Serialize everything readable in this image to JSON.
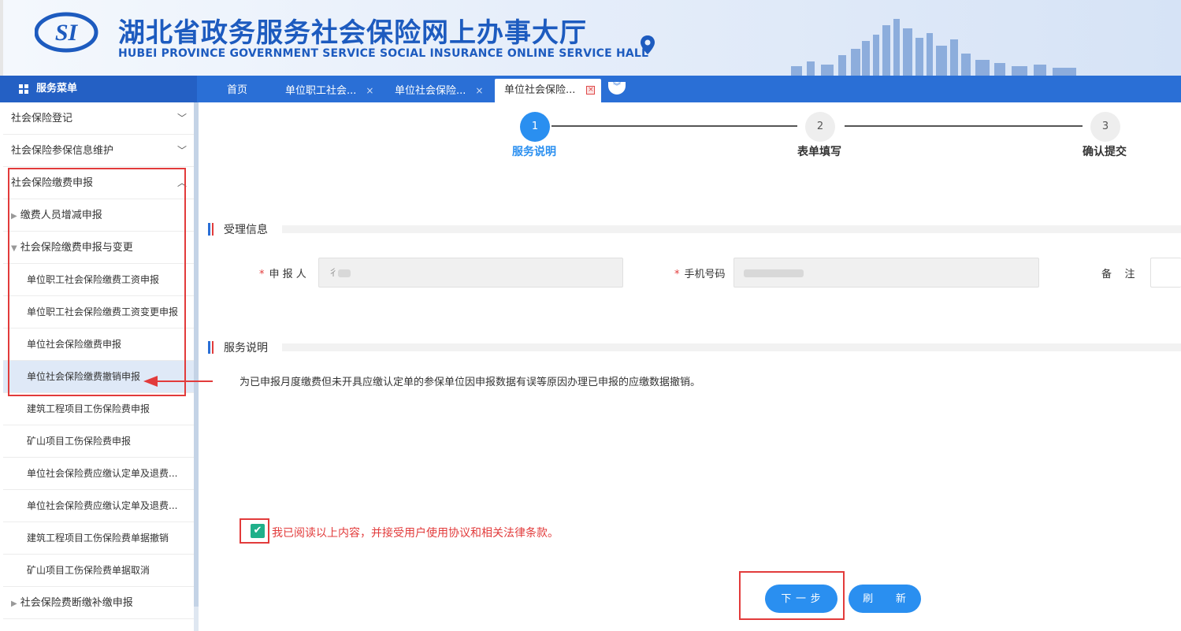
{
  "header": {
    "title": "湖北省政务服务社会保险网上办事大厅",
    "subtitle": "HUBEI PROVINCE GOVERNMENT SERVICE SOCIAL INSURANCE ONLINE SERVICE HALL",
    "logo_text": "SI"
  },
  "nav": {
    "menu_title": "服务菜单",
    "tabs": [
      {
        "label": "首页",
        "closable": false
      },
      {
        "label": "单位职工社会...",
        "closable": true
      },
      {
        "label": "单位社会保险...",
        "closable": true
      },
      {
        "label": "单位社会保险...",
        "closable": true,
        "active": true
      }
    ],
    "close_glyph": "×"
  },
  "sidebar": {
    "groups": [
      {
        "label": "社会保险登记",
        "icon": "chevron-down-icon",
        "chev": "﹀"
      },
      {
        "label": "社会保险参保信息维护",
        "icon": "chevron-down-icon",
        "chev": "﹀"
      },
      {
        "label": "社会保险缴费申报",
        "icon": "chevron-up-icon",
        "chev": "︿"
      }
    ],
    "subgroups": [
      {
        "label": "缴费人员增减申报",
        "tri": "▶"
      },
      {
        "label": "社会保险缴费申报与变更",
        "tri": "▼"
      }
    ],
    "leaves": [
      {
        "label": "单位职工社会保险缴费工资申报"
      },
      {
        "label": "单位职工社会保险缴费工资变更申报"
      },
      {
        "label": "单位社会保险缴费申报"
      },
      {
        "label": "单位社会保险缴费撤销申报",
        "selected": true
      },
      {
        "label": "建筑工程项目工伤保险费申报"
      },
      {
        "label": "矿山项目工伤保险费申报"
      },
      {
        "label": "单位社会保险费应缴认定单及退费..."
      },
      {
        "label": "单位社会保险费应缴认定单及退费..."
      },
      {
        "label": "建筑工程项目工伤保险费单据撤销"
      },
      {
        "label": "矿山项目工伤保险费单据取消"
      }
    ],
    "last_group": {
      "label": "社会保险费断缴补缴申报",
      "tri": "▶"
    }
  },
  "steps": [
    {
      "number": "1",
      "label": "服务说明",
      "status": "current"
    },
    {
      "number": "2",
      "label": "表单填写",
      "status": "todo"
    },
    {
      "number": "3",
      "label": "确认提交",
      "status": "todo"
    }
  ],
  "accept_info": {
    "section_title": "受理信息",
    "applicant_label": "申 报 人",
    "applicant_value": "彳",
    "phone_label": "手机号码",
    "remark_label": "备    注",
    "required_mark": "*"
  },
  "service_desc": {
    "section_title": "服务说明",
    "text": "为已申报月度缴费但未开具应缴认定单的参保单位因申报数据有误等原因办理已申报的应缴数据撤销。"
  },
  "agreement": {
    "checked": true,
    "check_glyph": "✔",
    "text": "我已阅读以上内容，并接受用户使用协议和相关法律条款。"
  },
  "buttons": {
    "next": "下 一 步",
    "refresh": "刷      新"
  },
  "colors": {
    "brand_blue": "#2a6fd6",
    "step_active": "#2a8ff0",
    "highlight_red": "#e23b3b",
    "check_green": "#1fb08a"
  }
}
